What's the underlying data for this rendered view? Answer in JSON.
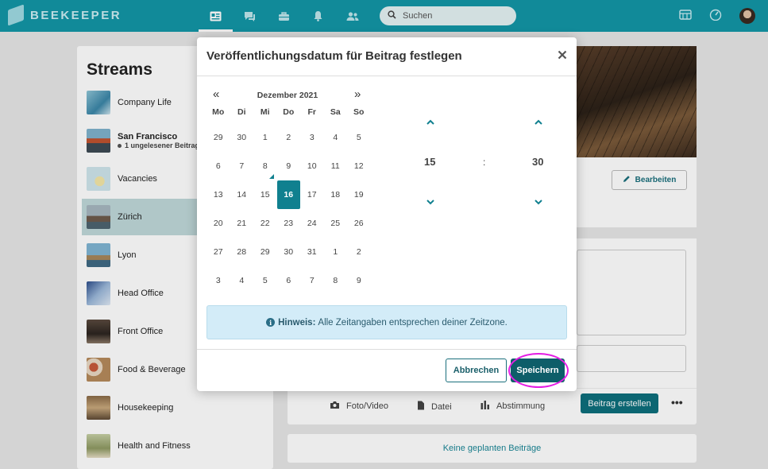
{
  "app": {
    "logo_text": "BEEKEEPER"
  },
  "topnav": {
    "items": [
      {
        "name": "home",
        "icon": "news-feed-icon"
      },
      {
        "name": "chats",
        "icon": "chat-icon"
      },
      {
        "name": "tools",
        "icon": "toolbox-icon"
      },
      {
        "name": "notifications",
        "icon": "bell-icon"
      },
      {
        "name": "people",
        "icon": "people-icon"
      }
    ],
    "search_placeholder": "Suchen"
  },
  "streams": {
    "title": "Streams",
    "items": [
      {
        "label": "Company Life",
        "sub": ""
      },
      {
        "label": "San Francisco",
        "sub": "1 ungelesener Beitrag"
      },
      {
        "label": "Vacancies",
        "sub": ""
      },
      {
        "label": "Zürich",
        "sub": ""
      },
      {
        "label": "Lyon",
        "sub": ""
      },
      {
        "label": "Head Office",
        "sub": ""
      },
      {
        "label": "Front Office",
        "sub": ""
      },
      {
        "label": "Food & Beverage",
        "sub": ""
      },
      {
        "label": "Housekeeping",
        "sub": ""
      },
      {
        "label": "Health and Fitness",
        "sub": ""
      }
    ],
    "active_index": 3
  },
  "stream_page": {
    "edit_label": "Bearbeiten",
    "actions": {
      "photo": "Foto/Video",
      "file": "Datei",
      "poll": "Abstimmung"
    },
    "create_post_label": "Beitrag erstellen",
    "more_label": "•••",
    "no_scheduled": "Keine geplanten Beiträge"
  },
  "modal": {
    "title": "Veröffentlichungsdatum für Beitrag festlegen",
    "close": "✕",
    "calendar": {
      "prev": "«",
      "next": "»",
      "month": "Dezember 2021",
      "weekdays": [
        "Mo",
        "Di",
        "Mi",
        "Do",
        "Fr",
        "Sa",
        "So"
      ],
      "weeks": [
        [
          "29",
          "30",
          "1",
          "2",
          "3",
          "4",
          "5"
        ],
        [
          "6",
          "7",
          "8",
          "9",
          "10",
          "11",
          "12"
        ],
        [
          "13",
          "14",
          "15",
          "16",
          "17",
          "18",
          "19"
        ],
        [
          "20",
          "21",
          "22",
          "23",
          "24",
          "25",
          "26"
        ],
        [
          "27",
          "28",
          "29",
          "30",
          "31",
          "1",
          "2"
        ],
        [
          "3",
          "4",
          "5",
          "6",
          "7",
          "8",
          "9"
        ]
      ],
      "selected": "16",
      "today": "8"
    },
    "time": {
      "hour": "15",
      "minute": "30",
      "separator": ":"
    },
    "hint": {
      "label": "Hinweis:",
      "text": "Alle Zeitangaben entsprechen deiner Zeitzone."
    },
    "cancel_label": "Abbrechen",
    "save_label": "Speichern"
  },
  "colors": {
    "brand": "#1396a6",
    "accent": "#10808f",
    "highlight": "#e41ee4"
  }
}
